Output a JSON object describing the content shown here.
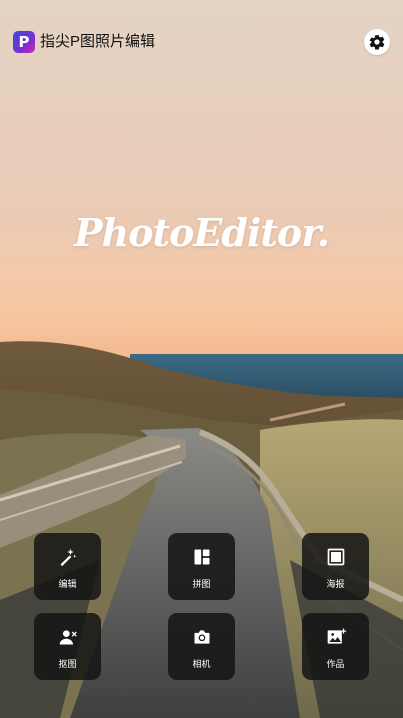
{
  "app": {
    "title": "指尖P图照片编辑",
    "icon_letter": "P",
    "brand_colors": [
      "#3a4bd8",
      "#d024b8"
    ]
  },
  "header": {
    "settings_icon": "gear-icon"
  },
  "hero": {
    "logo_text": "PhotoEditor."
  },
  "actions": [
    {
      "label": "编辑",
      "icon": "magic-wand-icon"
    },
    {
      "label": "拼图",
      "icon": "collage-icon"
    },
    {
      "label": "海报",
      "icon": "poster-icon"
    },
    {
      "label": "抠图",
      "icon": "cutout-person-icon"
    },
    {
      "label": "相机",
      "icon": "camera-icon"
    },
    {
      "label": "作品",
      "icon": "gallery-icon"
    }
  ]
}
